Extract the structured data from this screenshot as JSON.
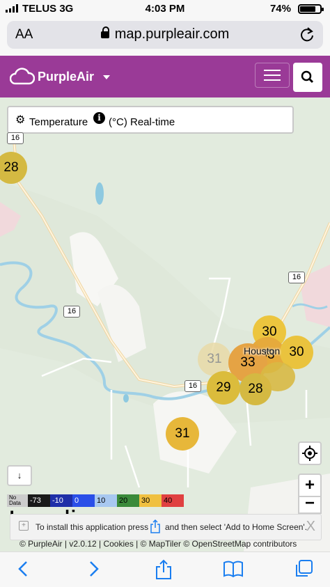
{
  "status_bar": {
    "carrier": "TELUS",
    "network": "3G",
    "time": "4:03 PM",
    "battery": "74%"
  },
  "browser": {
    "aa_label": "AA",
    "url": "map.purpleair.com"
  },
  "header": {
    "brand": "PurpleAir"
  },
  "sensor_select": {
    "label": "Temperature",
    "info_glyph": "i",
    "unit_label": "(°C) Real-time"
  },
  "markers": [
    {
      "value": "28",
      "color": "#d4b942"
    },
    {
      "value": "30",
      "color": "#ecc53e"
    },
    {
      "value": "31",
      "color": "#e9dba8"
    },
    {
      "value": "33",
      "color": "#e6aa3c"
    },
    {
      "value": "30",
      "color": "#eac33e"
    },
    {
      "value": "33",
      "color": "#e5a344"
    },
    {
      "value": "29",
      "color": "#dbbc3c"
    },
    {
      "value": "28",
      "color": "#d4b942"
    },
    {
      "value": "31",
      "color": "#e7b73a"
    }
  ],
  "place_label": "Houston",
  "road_shields": [
    "16",
    "16",
    "16",
    "16"
  ],
  "legend": [
    {
      "label": "No Data",
      "color": "#cccccc"
    },
    {
      "label": "-73",
      "color": "#1a1a1a"
    },
    {
      "label": "-10",
      "color": "#1f2fa8"
    },
    {
      "label": "0",
      "color": "#2a4fe8"
    },
    {
      "label": "10",
      "color": "#a8c8f0"
    },
    {
      "label": "20",
      "color": "#3a8a3a"
    },
    {
      "label": "30",
      "color": "#f0c040"
    },
    {
      "label": "40",
      "color": "#e04040"
    }
  ],
  "loading_text": "Loading",
  "install_prompt": {
    "text_before": "To install this application press",
    "text_after": "and then select 'Add to Home Screen'.",
    "close": "X"
  },
  "attribution": "© PurpleAir | v2.0.12 | Cookies | © MapTiler © OpenStreetMap contributors",
  "toolbar": {
    "icons": [
      "back-icon",
      "forward-icon",
      "share-icon",
      "bookmarks-icon",
      "tabs-icon"
    ]
  }
}
